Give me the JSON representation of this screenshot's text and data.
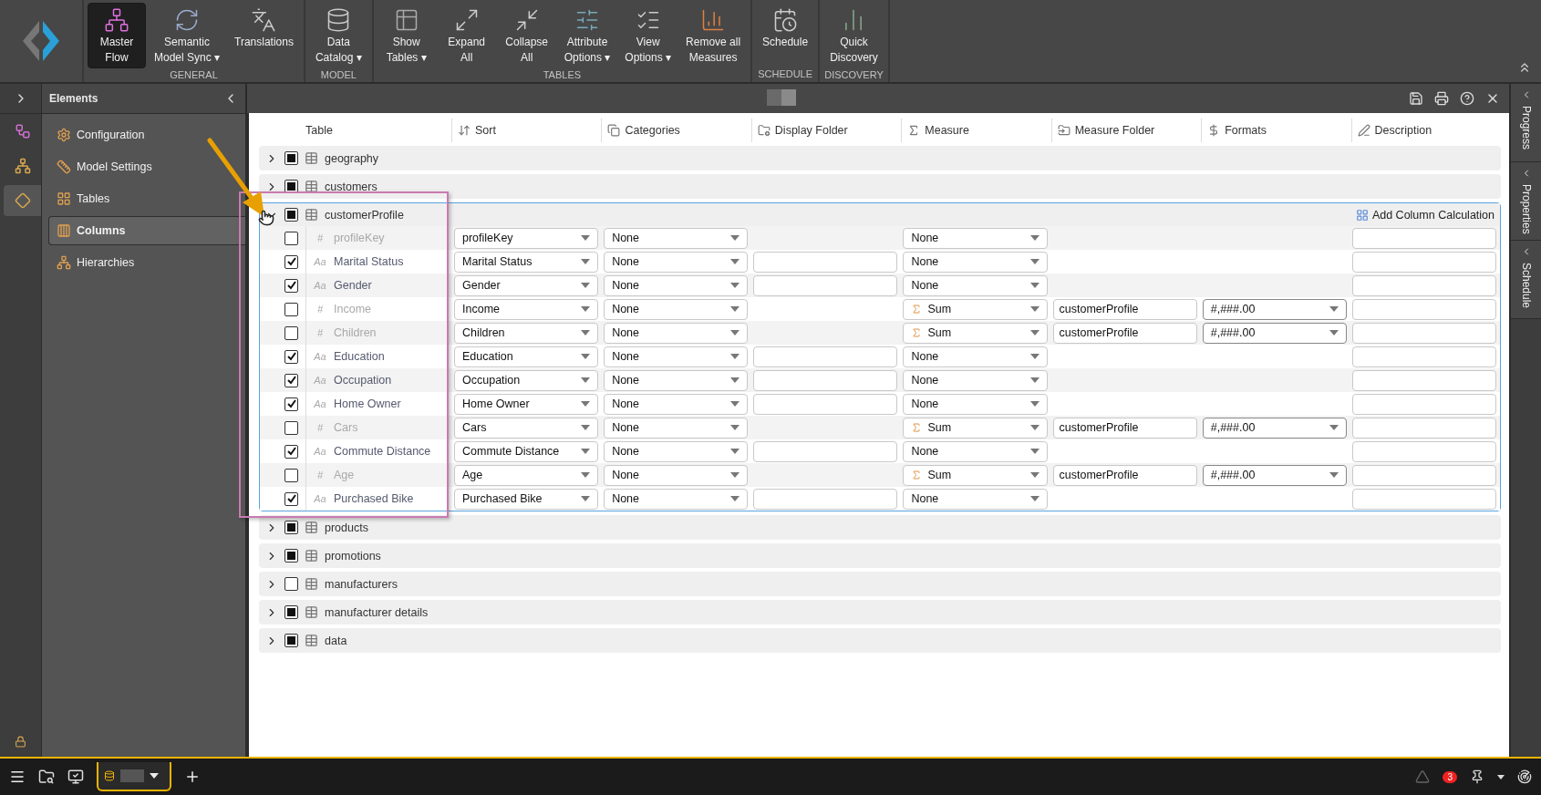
{
  "toolbar": {
    "groups": [
      {
        "label": "GENERAL",
        "buttons": [
          {
            "lines": [
              "Master",
              "Flow"
            ],
            "selected": true
          },
          {
            "lines": [
              "Semantic",
              "Model Sync ▾"
            ],
            "selected": false
          },
          {
            "lines": [
              "Translations"
            ],
            "selected": false
          }
        ]
      },
      {
        "label": "MODEL",
        "buttons": [
          {
            "lines": [
              "Data",
              "Catalog ▾"
            ],
            "selected": false
          }
        ]
      },
      {
        "label": "TABLES",
        "buttons": [
          {
            "lines": [
              "Show",
              "Tables ▾"
            ],
            "selected": false
          },
          {
            "lines": [
              "Expand",
              "All"
            ],
            "selected": false
          },
          {
            "lines": [
              "Collapse",
              "All"
            ],
            "selected": false
          },
          {
            "lines": [
              "Attribute",
              "Options ▾"
            ],
            "selected": false
          },
          {
            "lines": [
              "View",
              "Options ▾"
            ],
            "selected": false
          },
          {
            "lines": [
              "Remove all",
              "Measures"
            ],
            "selected": false
          }
        ]
      },
      {
        "label": "SCHEDULE",
        "buttons": [
          {
            "lines": [
              "Schedule"
            ],
            "selected": false
          }
        ]
      },
      {
        "label": "DISCOVERY",
        "buttons": [
          {
            "lines": [
              "Quick",
              "Discovery"
            ],
            "selected": false
          }
        ]
      }
    ]
  },
  "rail": [
    {
      "selected": false
    },
    {
      "selected": false
    },
    {
      "selected": true
    }
  ],
  "elements": {
    "title": "Elements",
    "items": [
      {
        "label": "Configuration",
        "selected": false
      },
      {
        "label": "Model Settings",
        "selected": false
      },
      {
        "label": "Tables",
        "selected": false
      },
      {
        "label": "Columns",
        "selected": true
      },
      {
        "label": "Hierarchies",
        "selected": false
      }
    ]
  },
  "grid": {
    "columns": [
      "Table",
      "Sort",
      "Categories",
      "Display Folder",
      "Measure",
      "Measure Folder",
      "Formats",
      "Description"
    ],
    "tables": [
      {
        "name": "geography",
        "checked": true,
        "expanded": false
      },
      {
        "name": "customers",
        "checked": true,
        "expanded": false
      },
      {
        "name": "customerProfile",
        "checked": true,
        "expanded": true,
        "action": "Add Column Calculation",
        "fields": [
          {
            "kind": "key",
            "type_icon": "#",
            "name": "profileKey",
            "checked": false,
            "sort": "profileKey",
            "category": "None",
            "measure": "None"
          },
          {
            "kind": "text",
            "type_icon": "Aa",
            "name": "Marital Status",
            "checked": true,
            "sort": "Marital Status",
            "category": "None",
            "measure": "None"
          },
          {
            "kind": "text",
            "type_icon": "Aa",
            "name": "Gender",
            "checked": true,
            "sort": "Gender",
            "category": "None",
            "measure": "None"
          },
          {
            "kind": "number",
            "type_icon": "#",
            "name": "Income",
            "checked": false,
            "sort": "Income",
            "category": "None",
            "measure": "Sum",
            "measure_folder": "customerProfile",
            "format": "#,###.00"
          },
          {
            "kind": "number",
            "type_icon": "#",
            "name": "Children",
            "checked": false,
            "sort": "Children",
            "category": "None",
            "measure": "Sum",
            "measure_folder": "customerProfile",
            "format": "#,###.00"
          },
          {
            "kind": "text",
            "type_icon": "Aa",
            "name": "Education",
            "checked": true,
            "sort": "Education",
            "category": "None",
            "measure": "None"
          },
          {
            "kind": "text",
            "type_icon": "Aa",
            "name": "Occupation",
            "checked": true,
            "sort": "Occupation",
            "category": "None",
            "measure": "None"
          },
          {
            "kind": "text",
            "type_icon": "Aa",
            "name": "Home Owner",
            "checked": true,
            "sort": "Home Owner",
            "category": "None",
            "measure": "None"
          },
          {
            "kind": "number",
            "type_icon": "#",
            "name": "Cars",
            "checked": false,
            "sort": "Cars",
            "category": "None",
            "measure": "Sum",
            "measure_folder": "customerProfile",
            "format": "#,###.00"
          },
          {
            "kind": "text",
            "type_icon": "Aa",
            "name": "Commute Distance",
            "checked": true,
            "sort": "Commute Distance",
            "category": "None",
            "measure": "None"
          },
          {
            "kind": "number",
            "type_icon": "#",
            "name": "Age",
            "checked": false,
            "sort": "Age",
            "category": "None",
            "measure": "Sum",
            "measure_folder": "customerProfile",
            "format": "#,###.00"
          },
          {
            "kind": "text",
            "type_icon": "Aa",
            "name": "Purchased Bike",
            "checked": true,
            "sort": "Purchased Bike",
            "category": "None",
            "measure": "None"
          }
        ]
      },
      {
        "name": "products",
        "checked": true,
        "expanded": false
      },
      {
        "name": "promotions",
        "checked": true,
        "expanded": false
      },
      {
        "name": "manufacturers",
        "checked": false,
        "expanded": false
      },
      {
        "name": "manufacturer details",
        "checked": true,
        "expanded": false
      },
      {
        "name": "data",
        "checked": true,
        "expanded": false
      }
    ]
  },
  "right_tabs": [
    "Progress",
    "Properties",
    "Schedule"
  ],
  "taskbar": {
    "badge": "3"
  }
}
